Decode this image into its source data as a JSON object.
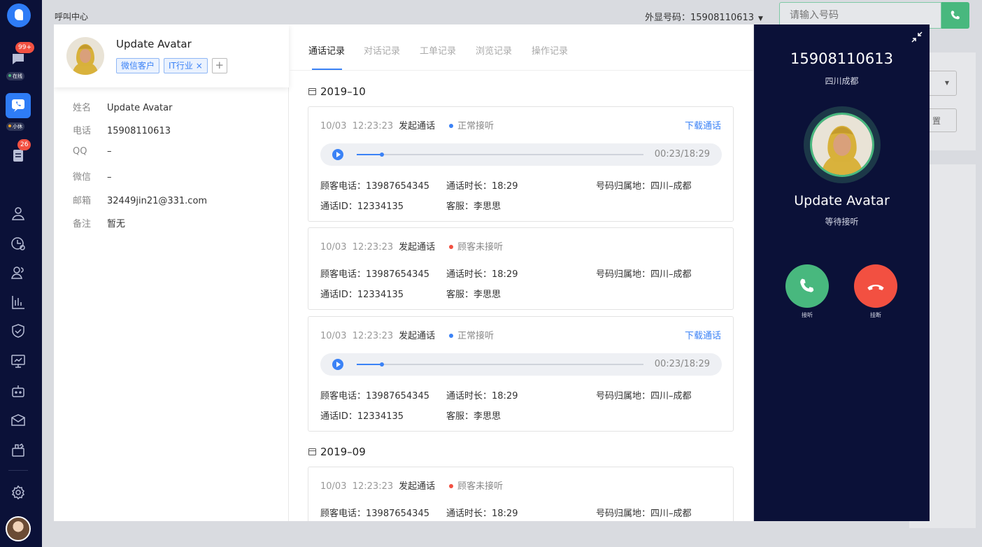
{
  "nav": {
    "badges": {
      "messages": "99+",
      "tickets": "26"
    },
    "status": {
      "online": "在线",
      "xiaoti": "小休"
    },
    "icons": [
      "chat-icon",
      "phone-chat-icon",
      "ticket-icon",
      "user-icon",
      "clock-chart-icon",
      "contacts-icon",
      "bar-chart-icon",
      "shield-icon",
      "monitor-icon",
      "robot-icon",
      "mailbox-icon",
      "apps-icon",
      "settings-icon"
    ]
  },
  "topbar": {
    "title": "呼叫中心",
    "caller_id_label": "外显号码：",
    "caller_id_value": "15908110613",
    "number_placeholder": "请输入号码"
  },
  "background": {
    "reset_label": "置"
  },
  "customer": {
    "name": "Update Avatar",
    "tags": [
      "微信客户",
      "IT行业"
    ],
    "tag_add": "+",
    "fields": [
      {
        "label": "姓名",
        "value": "Update Avatar"
      },
      {
        "label": "电话",
        "value": "15908110613"
      },
      {
        "label": "QQ",
        "value": "–"
      },
      {
        "label": "微信",
        "value": "–"
      },
      {
        "label": "邮箱",
        "value": "32449jin21@331.com"
      },
      {
        "label": "备注",
        "value": "暂无"
      }
    ]
  },
  "tabs": [
    "通话记录",
    "对话记录",
    "工单记录",
    "浏览记录",
    "操作记录"
  ],
  "groups": [
    {
      "month": "2019–10"
    },
    {
      "month": "2019–09"
    }
  ],
  "records": [
    {
      "date": "10/03",
      "time": "12:23:23",
      "action": "发起通话",
      "status": "正常接听",
      "status_color": "#3b82f6",
      "download": "下载通话",
      "player_time": "00:23/18:29",
      "progress": 0.087,
      "phone_label": "顾客电话：",
      "phone": "13987654345",
      "duration_label": "通话时长：",
      "duration": "18:29",
      "loc_label": "号码归属地：",
      "loc": "四川–成都",
      "id_label": "通话ID：",
      "id": "12334135",
      "agent_label": "客服：",
      "agent": "李思思"
    },
    {
      "date": "10/03",
      "time": "12:23:23",
      "action": "发起通话",
      "status": "顾客未接听",
      "status_color": "#f25041",
      "download": "",
      "player_time": "",
      "progress": 0,
      "phone_label": "顾客电话：",
      "phone": "13987654345",
      "duration_label": "通话时长：",
      "duration": "18:29",
      "loc_label": "号码归属地：",
      "loc": "四川–成都",
      "id_label": "通话ID：",
      "id": "12334135",
      "agent_label": "客服：",
      "agent": "李思思"
    },
    {
      "date": "10/03",
      "time": "12:23:23",
      "action": "发起通话",
      "status": "正常接听",
      "status_color": "#3b82f6",
      "download": "下载通话",
      "player_time": "00:23/18:29",
      "progress": 0.087,
      "phone_label": "顾客电话：",
      "phone": "13987654345",
      "duration_label": "通话时长：",
      "duration": "18:29",
      "loc_label": "号码归属地：",
      "loc": "四川–成都",
      "id_label": "通话ID：",
      "id": "12334135",
      "agent_label": "客服：",
      "agent": "李思思"
    },
    {
      "date": "10/03",
      "time": "12:23:23",
      "action": "发起通话",
      "status": "顾客未接听",
      "status_color": "#f25041",
      "download": "",
      "player_time": "",
      "progress": 0,
      "phone_label": "顾客电话：",
      "phone": "13987654345",
      "duration_label": "通话时长：",
      "duration": "18:29",
      "loc_label": "号码归属地：",
      "loc": "四川–成都",
      "id_label": "通话ID：",
      "id": "",
      "agent_label": "",
      "agent": ""
    }
  ],
  "call": {
    "number": "15908110613",
    "location": "四川成都",
    "name": "Update Avatar",
    "status": "等待接听",
    "answer_label": "接听",
    "hangup_label": "挂断",
    "answer_color": "#48b87e",
    "hangup_color": "#f25041"
  }
}
